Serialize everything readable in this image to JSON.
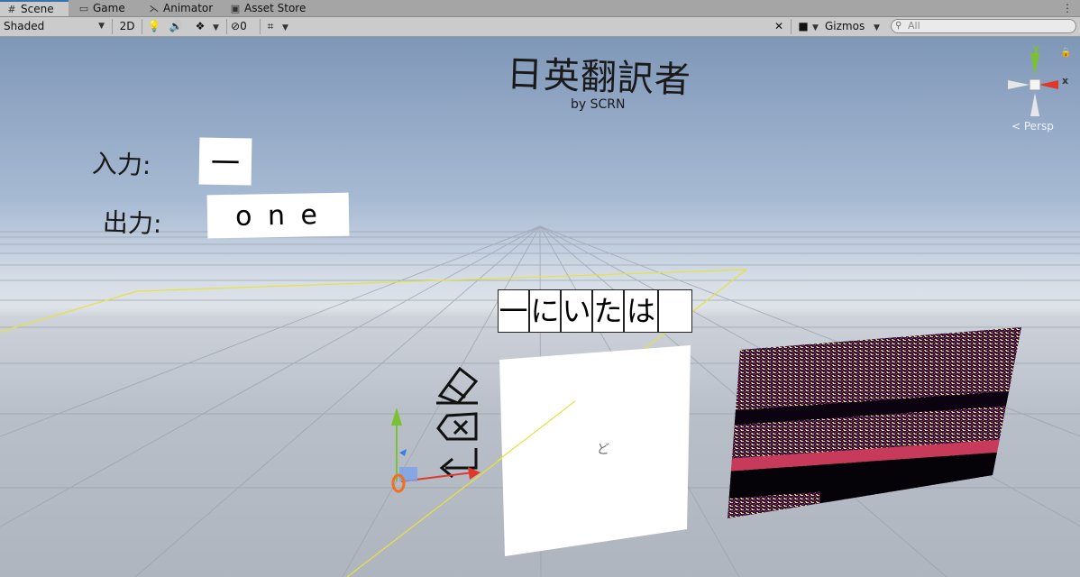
{
  "tabs": [
    {
      "label": "Scene",
      "icon": "grid-icon"
    },
    {
      "label": "Game",
      "icon": "gamepad-icon"
    },
    {
      "label": "Animator",
      "icon": "animator-icon"
    },
    {
      "label": "Asset Store",
      "icon": "store-bag-icon"
    }
  ],
  "toolbar": {
    "shading_mode": "Shaded",
    "mode_2d": "2D",
    "hidden_count": "0",
    "gizmos_label": "Gizmos",
    "search_placeholder": "All"
  },
  "scene": {
    "title": "日英翻訳者",
    "subtitle": "by SCRN",
    "input_label": "入力:",
    "input_value": "一",
    "output_label": "出力:",
    "output_value": "o n e",
    "candidates": [
      "一",
      "に",
      "い",
      "た",
      "は"
    ],
    "tool_icons": [
      "eraser-icon",
      "backspace-icon",
      "enter-icon"
    ],
    "canvas_glyph": "ど"
  },
  "gizmo": {
    "y_label": "y",
    "x_label": "x",
    "projection": "< Persp"
  },
  "colors": {
    "tab_active_accent": "#3a72b0",
    "axis_y": "#7ac231",
    "axis_x": "#e0382b",
    "axis_z": "#3a7fe0",
    "bounds_line": "#e8e23c",
    "spectro_band": "#c83a5a"
  }
}
